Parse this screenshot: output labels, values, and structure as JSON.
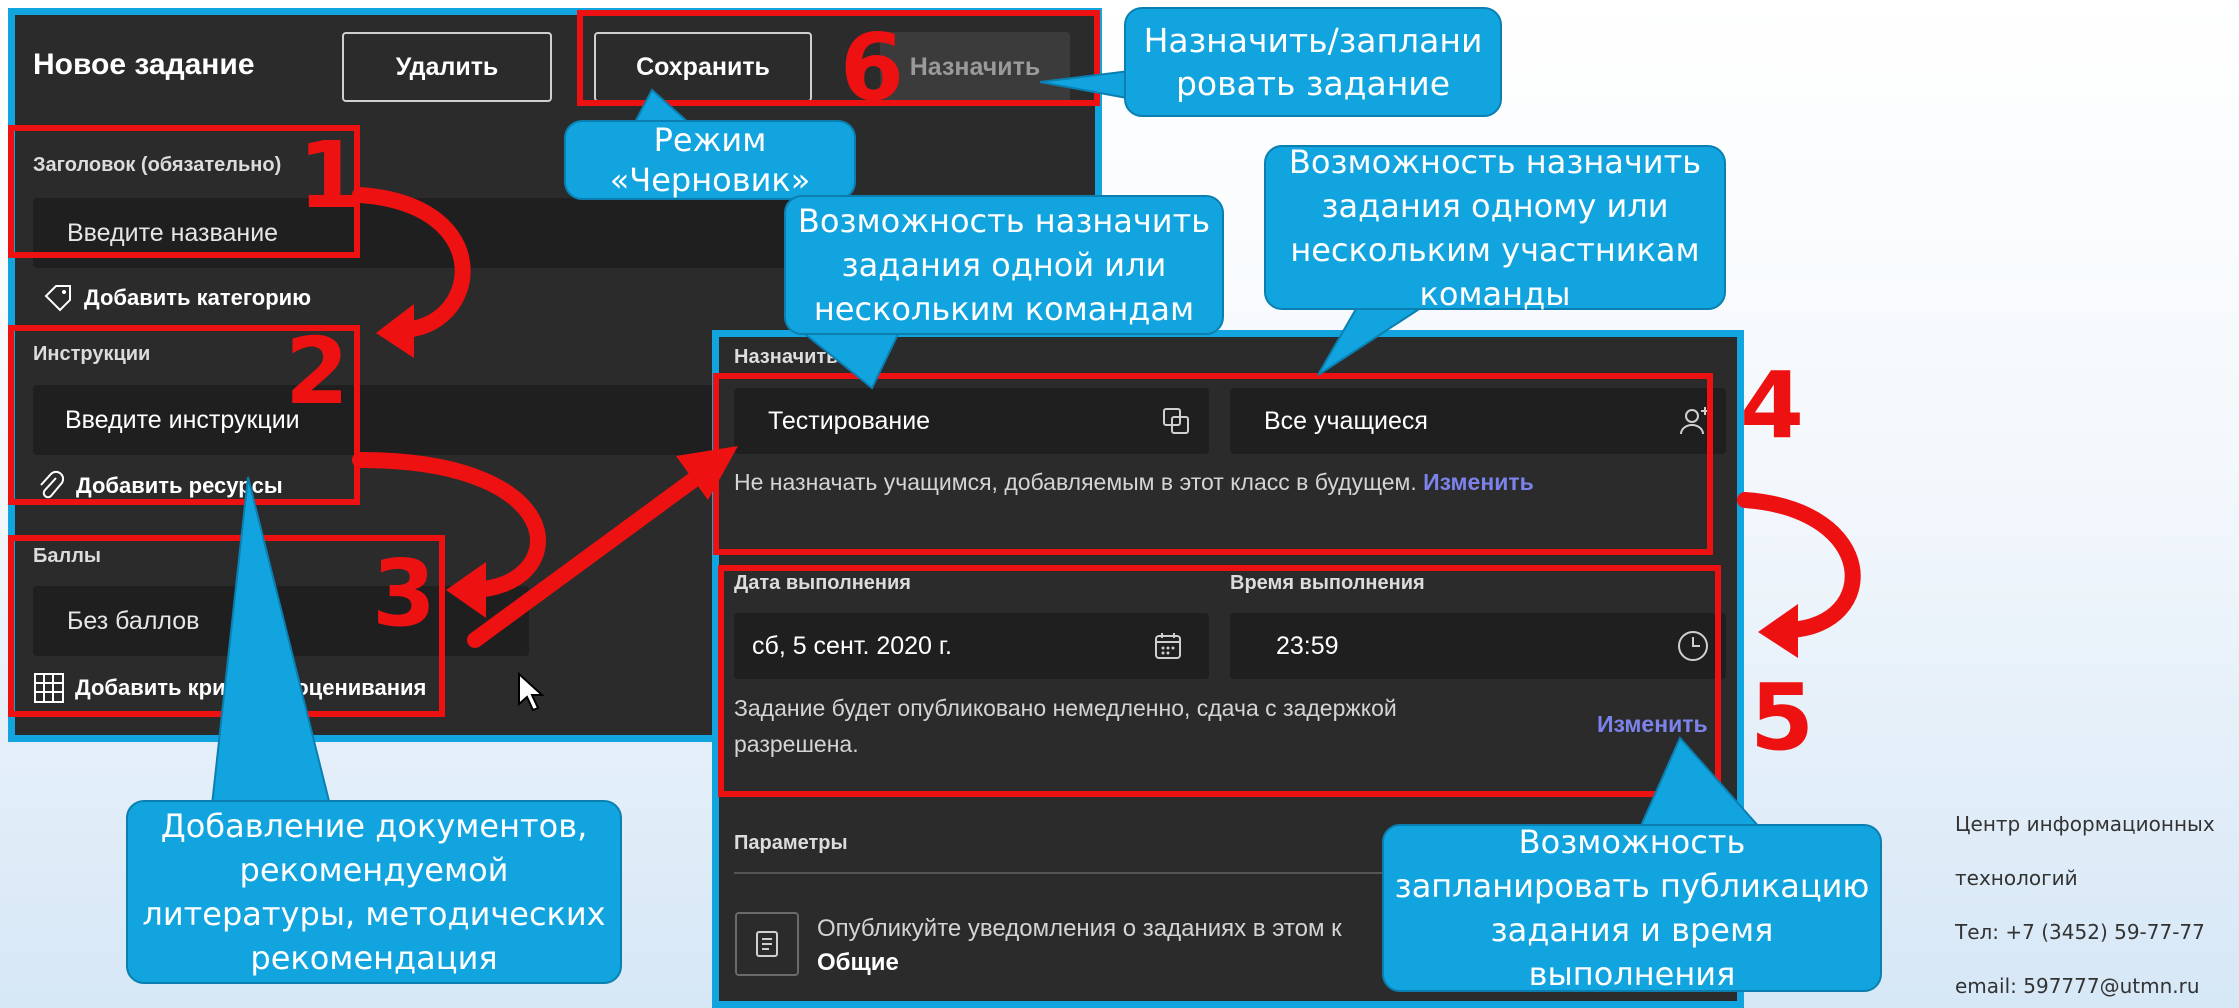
{
  "left": {
    "title": "Новое задание",
    "delete_label": "Удалить",
    "save_label": "Сохранить",
    "assign_label": "Назначить",
    "title_field_label": "Заголовок (обязательно)",
    "title_placeholder": "Введите название",
    "add_category": "Добавить категорию",
    "instructions_label": "Инструкции",
    "instructions_placeholder": "Введите инструкции",
    "add_resources": "Добавить ресурсы",
    "points_label": "Баллы",
    "points_value": "Без баллов",
    "add_rubric": "Добавить критерии оценивания"
  },
  "right": {
    "assign_label": "Назначить",
    "team_value": "Тестирование",
    "students_value": "Все учащиеся",
    "future_note": "Не назначать учащимся, добавляемым в этот класс в будущем.",
    "change_link": "Изменить",
    "due_date_label": "Дата выполнения",
    "due_date_value": "сб, 5 сент. 2020 г.",
    "due_time_label": "Время выполнения",
    "due_time_value": "23:59",
    "publish_note_1": "Задание будет опубликовано немедленно, сдача с задержкой",
    "publish_note_2": "разрешена.",
    "change_link_2": "Изменить",
    "params_label": "Параметры",
    "notify_text": "Опубликуйте уведомления о заданиях в этом к",
    "notify_channel": "Общие"
  },
  "numbers": [
    "1",
    "2",
    "3",
    "4",
    "5",
    "6"
  ],
  "callouts": {
    "assign_schedule": [
      "Назначить/заплани",
      "ровать задание"
    ],
    "draft": [
      "Режим",
      "«Черновик»"
    ],
    "teams": [
      "Возможность назначить",
      "задания одной или",
      "нескольким командам"
    ],
    "members": [
      "Возможность назначить",
      "задания одному или",
      "нескольким участникам",
      "команды"
    ],
    "documents": [
      "Добавление документов,",
      "рекомендуемой",
      "литературы, методических",
      "рекомендация"
    ],
    "schedule_publish": [
      "Возможность",
      "запланировать публикацию",
      "задания и время",
      "выполнения"
    ]
  },
  "contact": {
    "line1": "Центр информационных",
    "line2": "технологий",
    "phone": "Тел: +7 (3452) 59-77-77",
    "email": "email: 597777@utmn.ru"
  },
  "colors": {
    "panel": "#2b2b2b",
    "frame": "#12a4df",
    "highlight": "#ee1111",
    "callout": "#12a4df",
    "accent": "#7b83eb"
  }
}
